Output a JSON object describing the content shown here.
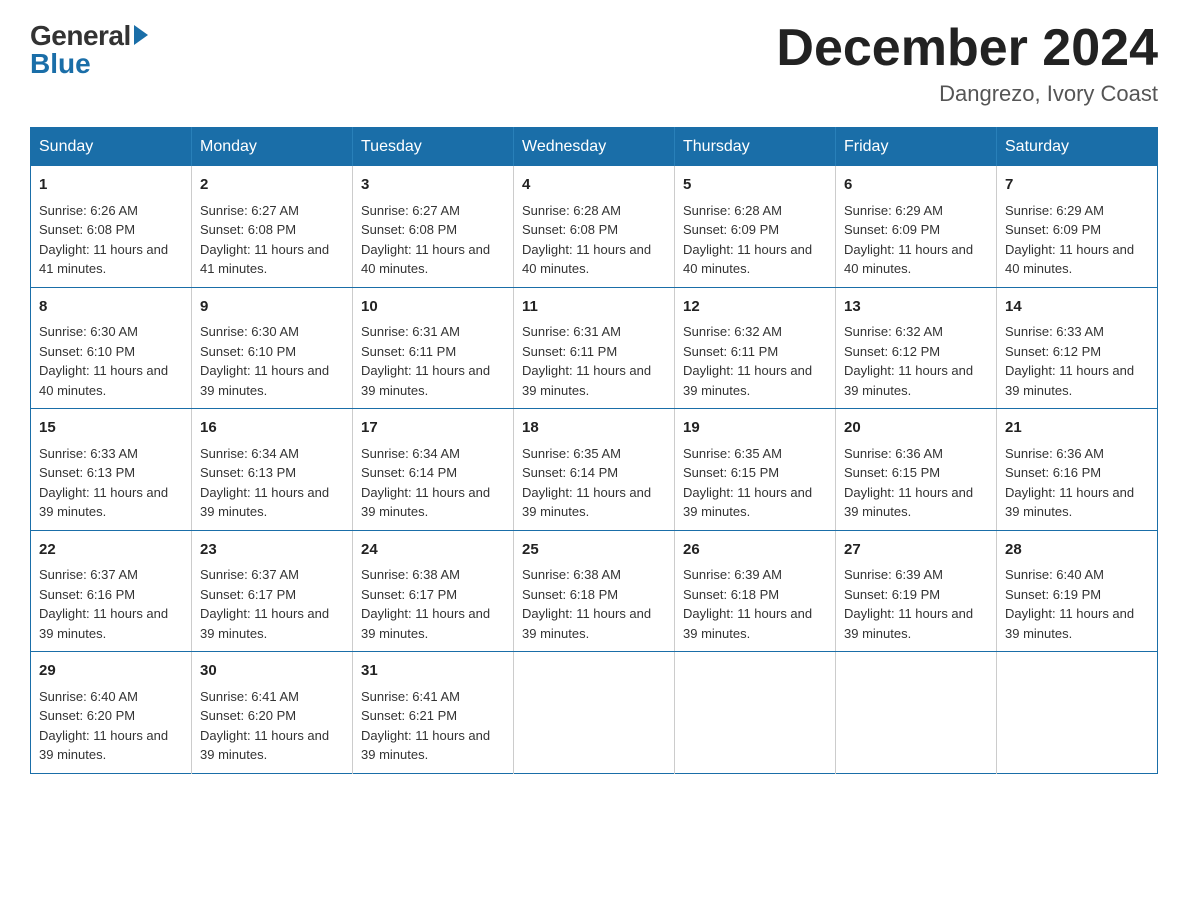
{
  "header": {
    "logo_general": "General",
    "logo_blue": "Blue",
    "month_title": "December 2024",
    "location": "Dangrezo, Ivory Coast"
  },
  "days_of_week": [
    "Sunday",
    "Monday",
    "Tuesday",
    "Wednesday",
    "Thursday",
    "Friday",
    "Saturday"
  ],
  "weeks": [
    [
      {
        "day": "1",
        "sunrise": "Sunrise: 6:26 AM",
        "sunset": "Sunset: 6:08 PM",
        "daylight": "Daylight: 11 hours and 41 minutes."
      },
      {
        "day": "2",
        "sunrise": "Sunrise: 6:27 AM",
        "sunset": "Sunset: 6:08 PM",
        "daylight": "Daylight: 11 hours and 41 minutes."
      },
      {
        "day": "3",
        "sunrise": "Sunrise: 6:27 AM",
        "sunset": "Sunset: 6:08 PM",
        "daylight": "Daylight: 11 hours and 40 minutes."
      },
      {
        "day": "4",
        "sunrise": "Sunrise: 6:28 AM",
        "sunset": "Sunset: 6:08 PM",
        "daylight": "Daylight: 11 hours and 40 minutes."
      },
      {
        "day": "5",
        "sunrise": "Sunrise: 6:28 AM",
        "sunset": "Sunset: 6:09 PM",
        "daylight": "Daylight: 11 hours and 40 minutes."
      },
      {
        "day": "6",
        "sunrise": "Sunrise: 6:29 AM",
        "sunset": "Sunset: 6:09 PM",
        "daylight": "Daylight: 11 hours and 40 minutes."
      },
      {
        "day": "7",
        "sunrise": "Sunrise: 6:29 AM",
        "sunset": "Sunset: 6:09 PM",
        "daylight": "Daylight: 11 hours and 40 minutes."
      }
    ],
    [
      {
        "day": "8",
        "sunrise": "Sunrise: 6:30 AM",
        "sunset": "Sunset: 6:10 PM",
        "daylight": "Daylight: 11 hours and 40 minutes."
      },
      {
        "day": "9",
        "sunrise": "Sunrise: 6:30 AM",
        "sunset": "Sunset: 6:10 PM",
        "daylight": "Daylight: 11 hours and 39 minutes."
      },
      {
        "day": "10",
        "sunrise": "Sunrise: 6:31 AM",
        "sunset": "Sunset: 6:11 PM",
        "daylight": "Daylight: 11 hours and 39 minutes."
      },
      {
        "day": "11",
        "sunrise": "Sunrise: 6:31 AM",
        "sunset": "Sunset: 6:11 PM",
        "daylight": "Daylight: 11 hours and 39 minutes."
      },
      {
        "day": "12",
        "sunrise": "Sunrise: 6:32 AM",
        "sunset": "Sunset: 6:11 PM",
        "daylight": "Daylight: 11 hours and 39 minutes."
      },
      {
        "day": "13",
        "sunrise": "Sunrise: 6:32 AM",
        "sunset": "Sunset: 6:12 PM",
        "daylight": "Daylight: 11 hours and 39 minutes."
      },
      {
        "day": "14",
        "sunrise": "Sunrise: 6:33 AM",
        "sunset": "Sunset: 6:12 PM",
        "daylight": "Daylight: 11 hours and 39 minutes."
      }
    ],
    [
      {
        "day": "15",
        "sunrise": "Sunrise: 6:33 AM",
        "sunset": "Sunset: 6:13 PM",
        "daylight": "Daylight: 11 hours and 39 minutes."
      },
      {
        "day": "16",
        "sunrise": "Sunrise: 6:34 AM",
        "sunset": "Sunset: 6:13 PM",
        "daylight": "Daylight: 11 hours and 39 minutes."
      },
      {
        "day": "17",
        "sunrise": "Sunrise: 6:34 AM",
        "sunset": "Sunset: 6:14 PM",
        "daylight": "Daylight: 11 hours and 39 minutes."
      },
      {
        "day": "18",
        "sunrise": "Sunrise: 6:35 AM",
        "sunset": "Sunset: 6:14 PM",
        "daylight": "Daylight: 11 hours and 39 minutes."
      },
      {
        "day": "19",
        "sunrise": "Sunrise: 6:35 AM",
        "sunset": "Sunset: 6:15 PM",
        "daylight": "Daylight: 11 hours and 39 minutes."
      },
      {
        "day": "20",
        "sunrise": "Sunrise: 6:36 AM",
        "sunset": "Sunset: 6:15 PM",
        "daylight": "Daylight: 11 hours and 39 minutes."
      },
      {
        "day": "21",
        "sunrise": "Sunrise: 6:36 AM",
        "sunset": "Sunset: 6:16 PM",
        "daylight": "Daylight: 11 hours and 39 minutes."
      }
    ],
    [
      {
        "day": "22",
        "sunrise": "Sunrise: 6:37 AM",
        "sunset": "Sunset: 6:16 PM",
        "daylight": "Daylight: 11 hours and 39 minutes."
      },
      {
        "day": "23",
        "sunrise": "Sunrise: 6:37 AM",
        "sunset": "Sunset: 6:17 PM",
        "daylight": "Daylight: 11 hours and 39 minutes."
      },
      {
        "day": "24",
        "sunrise": "Sunrise: 6:38 AM",
        "sunset": "Sunset: 6:17 PM",
        "daylight": "Daylight: 11 hours and 39 minutes."
      },
      {
        "day": "25",
        "sunrise": "Sunrise: 6:38 AM",
        "sunset": "Sunset: 6:18 PM",
        "daylight": "Daylight: 11 hours and 39 minutes."
      },
      {
        "day": "26",
        "sunrise": "Sunrise: 6:39 AM",
        "sunset": "Sunset: 6:18 PM",
        "daylight": "Daylight: 11 hours and 39 minutes."
      },
      {
        "day": "27",
        "sunrise": "Sunrise: 6:39 AM",
        "sunset": "Sunset: 6:19 PM",
        "daylight": "Daylight: 11 hours and 39 minutes."
      },
      {
        "day": "28",
        "sunrise": "Sunrise: 6:40 AM",
        "sunset": "Sunset: 6:19 PM",
        "daylight": "Daylight: 11 hours and 39 minutes."
      }
    ],
    [
      {
        "day": "29",
        "sunrise": "Sunrise: 6:40 AM",
        "sunset": "Sunset: 6:20 PM",
        "daylight": "Daylight: 11 hours and 39 minutes."
      },
      {
        "day": "30",
        "sunrise": "Sunrise: 6:41 AM",
        "sunset": "Sunset: 6:20 PM",
        "daylight": "Daylight: 11 hours and 39 minutes."
      },
      {
        "day": "31",
        "sunrise": "Sunrise: 6:41 AM",
        "sunset": "Sunset: 6:21 PM",
        "daylight": "Daylight: 11 hours and 39 minutes."
      },
      null,
      null,
      null,
      null
    ]
  ]
}
